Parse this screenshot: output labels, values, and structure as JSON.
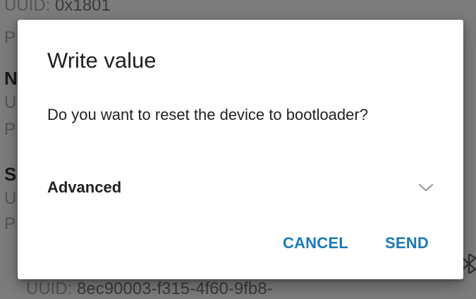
{
  "background": {
    "top_uuid_label": "UUID:",
    "top_uuid_value": "0x1801",
    "bottom_uuid_label": "UUID:",
    "bottom_uuid_value": "8ec90003-f315-4f60-9fb8-",
    "frag_p1": "P",
    "frag_n": "N",
    "frag_u1": "U",
    "frag_p2": "P",
    "frag_s": "S",
    "frag_u2": "U",
    "frag_p3": "P"
  },
  "dialog": {
    "title": "Write value",
    "message": "Do you want to reset the device to bootloader?",
    "advanced_label": "Advanced",
    "cancel_label": "CANCEL",
    "send_label": "SEND"
  },
  "colors": {
    "accent": "#1a7ab8",
    "text": "#212121",
    "scrim": "#7c7c7c"
  },
  "icons": {
    "advanced": "chevron-down-icon",
    "background_corner": "bluetooth-icon"
  }
}
